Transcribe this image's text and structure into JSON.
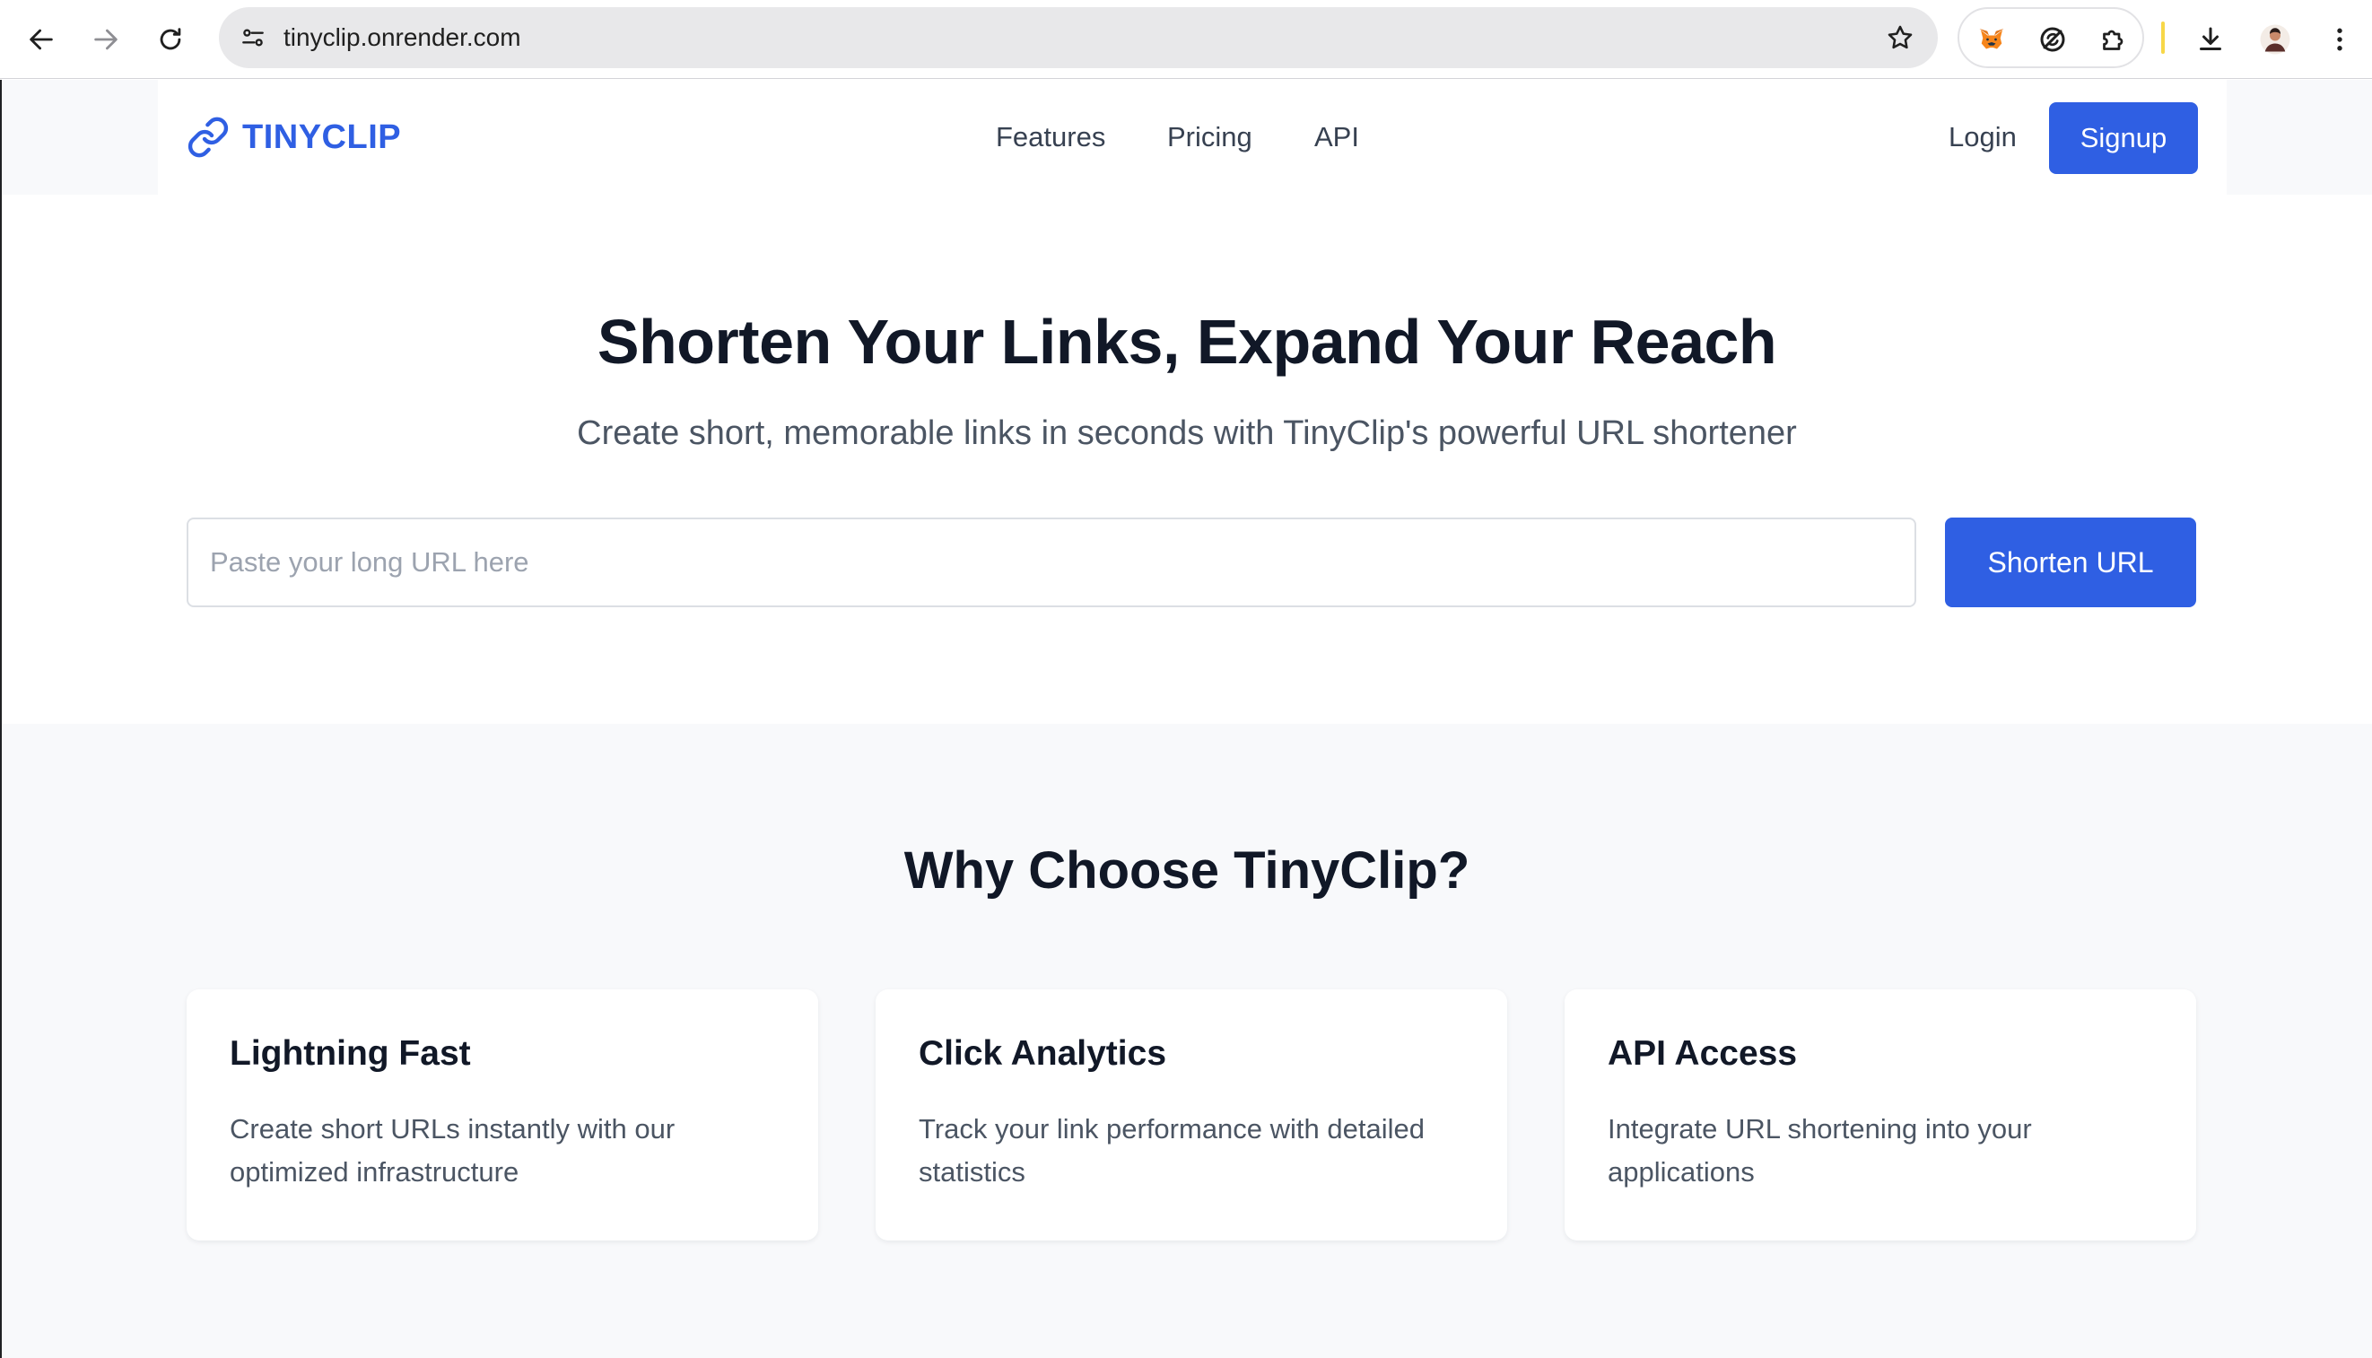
{
  "browser": {
    "url": "tinyclip.onrender.com"
  },
  "header": {
    "logo_text": "TINYCLIP",
    "nav": [
      "Features",
      "Pricing",
      "API"
    ],
    "login_label": "Login",
    "signup_label": "Signup"
  },
  "hero": {
    "title": "Shorten Your Links, Expand Your Reach",
    "subtitle": "Create short, memorable links in seconds with TinyClip's powerful URL shortener",
    "input_placeholder": "Paste your long URL here",
    "input_value": "",
    "button_label": "Shorten URL"
  },
  "features": {
    "title": "Why Choose TinyClip?",
    "cards": [
      {
        "title": "Lightning Fast",
        "desc": "Create short URLs instantly with our optimized infrastructure"
      },
      {
        "title": "Click Analytics",
        "desc": "Track your link performance with detailed statistics"
      },
      {
        "title": "API Access",
        "desc": "Integrate URL shortening into your applications"
      }
    ]
  },
  "colors": {
    "brand": "#2f5fe3",
    "heading": "#111827",
    "body_text": "#4b5563",
    "section_bg": "#f8f9fb"
  }
}
